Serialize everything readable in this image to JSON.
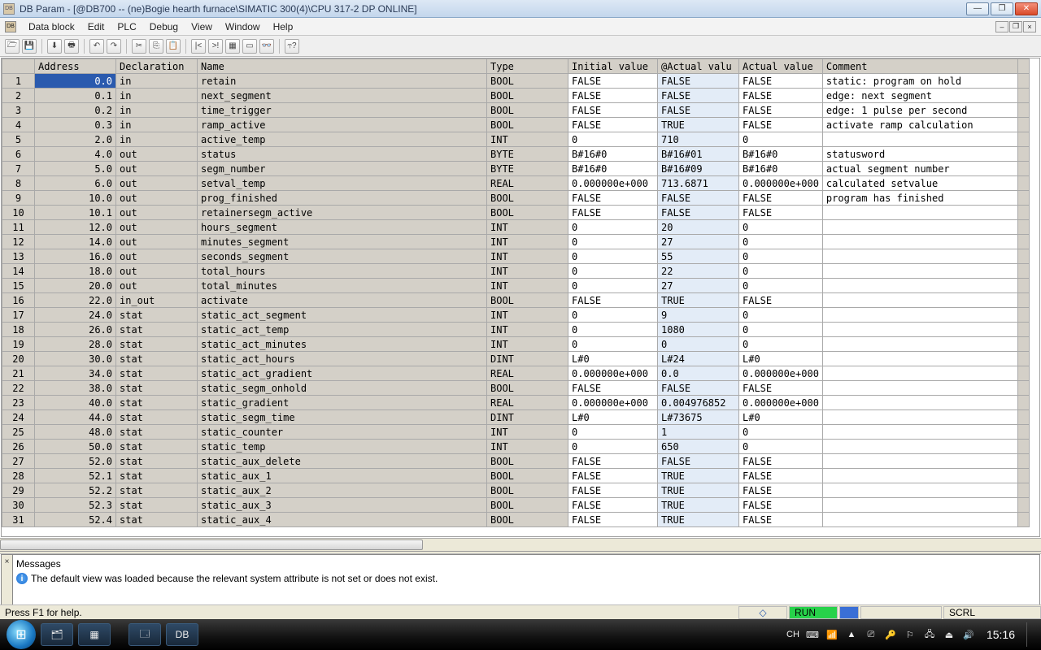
{
  "window": {
    "title": "DB Param - [@DB700 -- (ne)Bogie hearth furnace\\SIMATIC 300(4)\\CPU 317-2 DP  ONLINE]"
  },
  "menu": {
    "items": [
      "Data block",
      "Edit",
      "PLC",
      "Debug",
      "View",
      "Window",
      "Help"
    ]
  },
  "columns": {
    "address": "Address",
    "declaration": "Declaration",
    "name": "Name",
    "type": "Type",
    "initial_value": "Initial value",
    "at_actual_value": "@Actual valu",
    "actual_value": "Actual value",
    "comment": "Comment"
  },
  "rows": [
    {
      "n": "1",
      "addr": "0.0",
      "decl": "in",
      "name": "retain",
      "type": "BOOL",
      "ival": "FALSE",
      "atv": "FALSE",
      "actv": "FALSE",
      "cmt": "static: program on hold"
    },
    {
      "n": "2",
      "addr": "0.1",
      "decl": "in",
      "name": "next_segment",
      "type": "BOOL",
      "ival": "FALSE",
      "atv": "FALSE",
      "actv": "FALSE",
      "cmt": "edge: next segment"
    },
    {
      "n": "3",
      "addr": "0.2",
      "decl": "in",
      "name": "time_trigger",
      "type": "BOOL",
      "ival": "FALSE",
      "atv": "FALSE",
      "actv": "FALSE",
      "cmt": "edge: 1 pulse per second"
    },
    {
      "n": "4",
      "addr": "0.3",
      "decl": "in",
      "name": "ramp_active",
      "type": "BOOL",
      "ival": "FALSE",
      "atv": "TRUE",
      "actv": "FALSE",
      "cmt": "activate ramp calculation"
    },
    {
      "n": "5",
      "addr": "2.0",
      "decl": "in",
      "name": "active_temp",
      "type": "INT",
      "ival": "0",
      "atv": "710",
      "actv": "0",
      "cmt": ""
    },
    {
      "n": "6",
      "addr": "4.0",
      "decl": "out",
      "name": "status",
      "type": "BYTE",
      "ival": "B#16#0",
      "atv": "B#16#01",
      "actv": "B#16#0",
      "cmt": "statusword"
    },
    {
      "n": "7",
      "addr": "5.0",
      "decl": "out",
      "name": "segm_number",
      "type": "BYTE",
      "ival": "B#16#0",
      "atv": "B#16#09",
      "actv": "B#16#0",
      "cmt": "actual segment number"
    },
    {
      "n": "8",
      "addr": "6.0",
      "decl": "out",
      "name": "setval_temp",
      "type": "REAL",
      "ival": "0.000000e+000",
      "atv": "713.6871",
      "actv": "0.000000e+000",
      "cmt": "calculated setvalue"
    },
    {
      "n": "9",
      "addr": "10.0",
      "decl": "out",
      "name": "prog_finished",
      "type": "BOOL",
      "ival": "FALSE",
      "atv": "FALSE",
      "actv": "FALSE",
      "cmt": "program has finished"
    },
    {
      "n": "10",
      "addr": "10.1",
      "decl": "out",
      "name": "retainersegm_active",
      "type": "BOOL",
      "ival": "FALSE",
      "atv": "FALSE",
      "actv": "FALSE",
      "cmt": ""
    },
    {
      "n": "11",
      "addr": "12.0",
      "decl": "out",
      "name": "hours_segment",
      "type": "INT",
      "ival": "0",
      "atv": "20",
      "actv": "0",
      "cmt": ""
    },
    {
      "n": "12",
      "addr": "14.0",
      "decl": "out",
      "name": "minutes_segment",
      "type": "INT",
      "ival": "0",
      "atv": "27",
      "actv": "0",
      "cmt": ""
    },
    {
      "n": "13",
      "addr": "16.0",
      "decl": "out",
      "name": "seconds_segment",
      "type": "INT",
      "ival": "0",
      "atv": "55",
      "actv": "0",
      "cmt": ""
    },
    {
      "n": "14",
      "addr": "18.0",
      "decl": "out",
      "name": "total_hours",
      "type": "INT",
      "ival": "0",
      "atv": "22",
      "actv": "0",
      "cmt": ""
    },
    {
      "n": "15",
      "addr": "20.0",
      "decl": "out",
      "name": "total_minutes",
      "type": "INT",
      "ival": "0",
      "atv": "27",
      "actv": "0",
      "cmt": ""
    },
    {
      "n": "16",
      "addr": "22.0",
      "decl": "in_out",
      "name": "activate",
      "type": "BOOL",
      "ival": "FALSE",
      "atv": "TRUE",
      "actv": "FALSE",
      "cmt": ""
    },
    {
      "n": "17",
      "addr": "24.0",
      "decl": "stat",
      "name": "static_act_segment",
      "type": "INT",
      "ival": "0",
      "atv": "9",
      "actv": "0",
      "cmt": ""
    },
    {
      "n": "18",
      "addr": "26.0",
      "decl": "stat",
      "name": "static_act_temp",
      "type": "INT",
      "ival": "0",
      "atv": "1080",
      "actv": "0",
      "cmt": ""
    },
    {
      "n": "19",
      "addr": "28.0",
      "decl": "stat",
      "name": "static_act_minutes",
      "type": "INT",
      "ival": "0",
      "atv": "0",
      "actv": "0",
      "cmt": ""
    },
    {
      "n": "20",
      "addr": "30.0",
      "decl": "stat",
      "name": "static_act_hours",
      "type": "DINT",
      "ival": "L#0",
      "atv": "L#24",
      "actv": "L#0",
      "cmt": ""
    },
    {
      "n": "21",
      "addr": "34.0",
      "decl": "stat",
      "name": "static_act_gradient",
      "type": "REAL",
      "ival": "0.000000e+000",
      "atv": "0.0",
      "actv": "0.000000e+000",
      "cmt": ""
    },
    {
      "n": "22",
      "addr": "38.0",
      "decl": "stat",
      "name": "static_segm_onhold",
      "type": "BOOL",
      "ival": "FALSE",
      "atv": "FALSE",
      "actv": "FALSE",
      "cmt": ""
    },
    {
      "n": "23",
      "addr": "40.0",
      "decl": "stat",
      "name": "static_gradient",
      "type": "REAL",
      "ival": "0.000000e+000",
      "atv": "0.004976852",
      "actv": "0.000000e+000",
      "cmt": ""
    },
    {
      "n": "24",
      "addr": "44.0",
      "decl": "stat",
      "name": "static_segm_time",
      "type": "DINT",
      "ival": "L#0",
      "atv": "L#73675",
      "actv": "L#0",
      "cmt": ""
    },
    {
      "n": "25",
      "addr": "48.0",
      "decl": "stat",
      "name": "static_counter",
      "type": "INT",
      "ival": "0",
      "atv": "1",
      "actv": "0",
      "cmt": ""
    },
    {
      "n": "26",
      "addr": "50.0",
      "decl": "stat",
      "name": "static_temp",
      "type": "INT",
      "ival": "0",
      "atv": "650",
      "actv": "0",
      "cmt": ""
    },
    {
      "n": "27",
      "addr": "52.0",
      "decl": "stat",
      "name": "static_aux_delete",
      "type": "BOOL",
      "ival": "FALSE",
      "atv": "FALSE",
      "actv": "FALSE",
      "cmt": ""
    },
    {
      "n": "28",
      "addr": "52.1",
      "decl": "stat",
      "name": "static_aux_1",
      "type": "BOOL",
      "ival": "FALSE",
      "atv": "TRUE",
      "actv": "FALSE",
      "cmt": ""
    },
    {
      "n": "29",
      "addr": "52.2",
      "decl": "stat",
      "name": "static_aux_2",
      "type": "BOOL",
      "ival": "FALSE",
      "atv": "TRUE",
      "actv": "FALSE",
      "cmt": ""
    },
    {
      "n": "30",
      "addr": "52.3",
      "decl": "stat",
      "name": "static_aux_3",
      "type": "BOOL",
      "ival": "FALSE",
      "atv": "TRUE",
      "actv": "FALSE",
      "cmt": ""
    },
    {
      "n": "31",
      "addr": "52.4",
      "decl": "stat",
      "name": "static_aux_4",
      "type": "BOOL",
      "ival": "FALSE",
      "atv": "TRUE",
      "actv": "FALSE",
      "cmt": ""
    }
  ],
  "messages": {
    "header": "Messages",
    "text": "The default view was loaded because the relevant system attribute is not set or does not exist."
  },
  "status": {
    "help": "Press F1 for help.",
    "diamond": "◇",
    "run": "RUN",
    "scrl": "SCRL"
  },
  "tray": {
    "ime": "CH",
    "clock": "15:16"
  }
}
